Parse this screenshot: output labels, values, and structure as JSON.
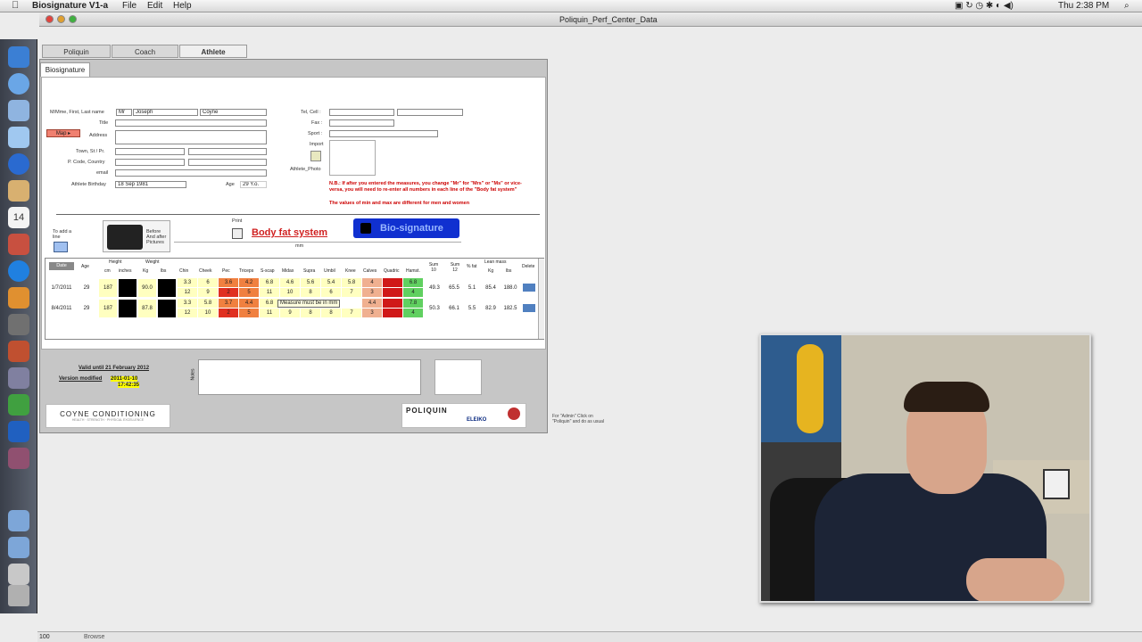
{
  "menubar": {
    "app_name": "Biosignature V1-a",
    "items": [
      "File",
      "Edit",
      "Help"
    ],
    "clock": "Thu 2:38 PM"
  },
  "window": {
    "title": "Poliquin_Perf_Center_Data"
  },
  "tabs": [
    "Poliquin",
    "Coach",
    "Athlete"
  ],
  "subtab": "Biosignature",
  "form": {
    "name_label": "M/Mme, First, Last name",
    "salutation": "Mr",
    "first_name": "Joseph",
    "last_name": "Coyne",
    "title_label": "Title",
    "address_label": "Address",
    "map_button": "Map",
    "town_label": "Town, St / Pr.",
    "pcode_label": "P. Code, Country",
    "email_label": "email",
    "birthday_label": "Athlete Birthday",
    "birthday": "18 Sep 1981",
    "age_label": "Age",
    "age": "29 Y.o.",
    "tel_label": "Tel, Cell :",
    "fax_label": "Fax :",
    "sport_label": "Sport :",
    "import_label": "Import",
    "photo_label": "Athlete_Photo",
    "note": "N.B.: If after you entered the measures, you change \"Mr\" for \"Mrs\" or \"Ms\" or vice-versa, you will need to re-enter all numbers in each line of the \"Body fat system\"",
    "note2": "The values of min and max are different for men and women"
  },
  "controls": {
    "add_line": "To add a line",
    "before_after": "Before And after Pictures",
    "print": "Print",
    "body_fat": "Body fat system",
    "bio_signature": "Bio-signature",
    "mm": "mm"
  },
  "table": {
    "headers": [
      "Date",
      "Age",
      "Height",
      "Weight",
      "Chin",
      "Cheek",
      "Pec",
      "Triceps",
      "S-scap",
      "Midax",
      "Supra",
      "Umbil",
      "Knee",
      "Calves",
      "Quadric",
      "Hamst.",
      "Sum 10",
      "Sum 12",
      "% fat",
      "Lean mass",
      "Delete"
    ],
    "subheaders": [
      "cm",
      "inches",
      "Kg",
      "lbs",
      "Kg",
      "lbs"
    ],
    "rows": [
      {
        "date": "1/7/2011",
        "age": "29",
        "cm": "187",
        "kg": "90.0",
        "top": [
          "3.3",
          "6",
          "3.6",
          "4.2",
          "6.8",
          "4.6",
          "5.6",
          "5.4",
          "5.8",
          "4",
          "",
          "6.8"
        ],
        "bottom": [
          "12",
          "9",
          "2",
          "5",
          "11",
          "10",
          "8",
          "6",
          "7",
          "3",
          "",
          "4"
        ],
        "sum10": "49.3",
        "sum12": "65.5",
        "fat": "5.1",
        "lean_kg": "85.4",
        "lean_lbs": "188.0"
      },
      {
        "date": "8/4/2011",
        "age": "29",
        "cm": "187",
        "kg": "87.8",
        "top": [
          "3.3",
          "5.8",
          "3.7",
          "4.4",
          "6.8",
          "",
          "",
          "",
          "",
          "4.4",
          "",
          "7.8"
        ],
        "bottom": [
          "12",
          "10",
          "2",
          "5",
          "11",
          "9",
          "8",
          "8",
          "7",
          "3",
          "",
          "4"
        ],
        "sum10": "50.3",
        "sum12": "66.1",
        "fat": "5.5",
        "lean_kg": "82.9",
        "lean_lbs": "182.5"
      }
    ],
    "tooltip": "Measure must be in mm"
  },
  "footer": {
    "valid_until": "Valid until 21 February 2012",
    "version_label": "Version modified",
    "version_date": "2011-01-10",
    "version_time": "17:42:35",
    "notes_label": "Notes",
    "coyne_logo": "COYNE CONDITIONING",
    "coyne_tagline": "HEALTH · STRENGTH · PHYSICAL EXCELLENCE",
    "poliquin_logo": "POLIQUIN",
    "eleiko": "ELEIKO",
    "admin_note": "For \"Admin\" Click on \"Poliquin\" and do as usual"
  },
  "statusbar": {
    "zoom": "100",
    "mode": "Browse"
  },
  "colors": {
    "orange": "#f08040",
    "red": "#e03020",
    "green": "#60d060",
    "yellow": "#ffffc0",
    "blue": "#1030d0"
  }
}
